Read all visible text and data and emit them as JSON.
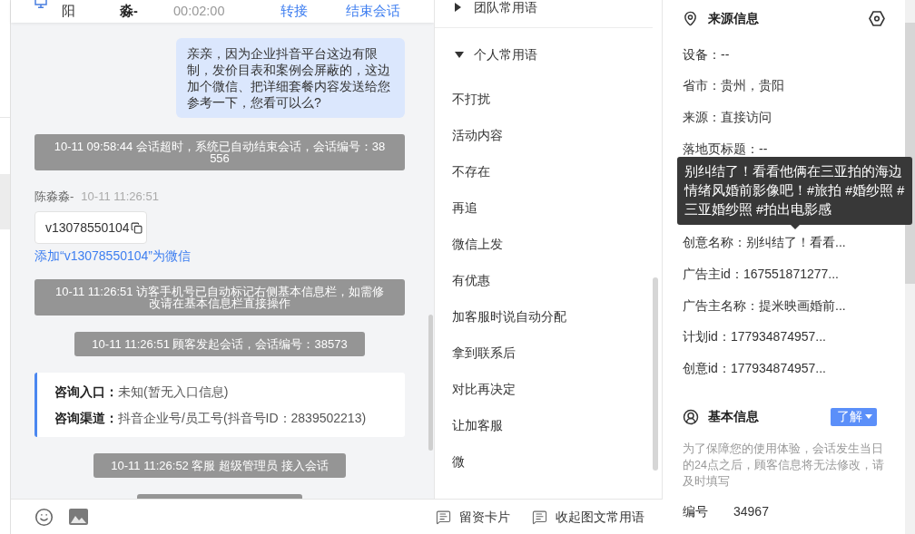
{
  "chat_header": {
    "column_1": "阳",
    "column_2": "淼-",
    "column_3": "00:02:00",
    "actions": [
      "转接",
      "结束会话"
    ]
  },
  "messages": [
    {
      "kind": "outgoing",
      "text": "亲亲，因为企业抖音平台这边有限制，发价目表和案例会屏蔽的，这边加个微信、把详细套餐内容发送给您参考一下，您看可以么?"
    },
    {
      "kind": "system",
      "text": "10-11 09:58:44 会话超时，系统已自动结束会话，会话编号：38556"
    },
    {
      "kind": "incoming",
      "sender": "陈淼淼-",
      "time": "10-11 11:26:51",
      "text": "v13078550104",
      "action": "添加“v13078550104”为微信"
    },
    {
      "kind": "system",
      "text": "10-11 11:26:51 访客手机号已自动标记右侧基本信息栏，如需修改请在基本信息栏直接操作"
    },
    {
      "kind": "system",
      "text": "10-11 11:26:51 顾客发起会话，会话编号：38573"
    },
    {
      "kind": "entry_info",
      "fields": [
        {
          "label": "咨询入口：",
          "value": "未知(暂无入口信息)"
        },
        {
          "label": "咨询渠道：",
          "value": "抖音企业号/员工号(抖音号ID：2839502213)"
        }
      ]
    },
    {
      "kind": "system",
      "text": "10-11 11:26:52 客服 超级管理员 接入会话"
    },
    {
      "kind": "system"
    }
  ],
  "phrase_groups": [
    {
      "title": "团队常用语",
      "expanded": false
    },
    {
      "title": "个人常用语",
      "expanded": true,
      "items": [
        "不打扰",
        "活动内容",
        "不存在",
        "再追",
        "微信上发",
        "有优惠",
        "加客服时说自动分配",
        "拿到联系后",
        "对比再决定",
        "让加客服",
        "微"
      ]
    }
  ],
  "toolbar": {
    "tools": [
      "留资卡片",
      "收起图文常用语"
    ]
  },
  "source_info": {
    "title": "来源信息",
    "rows_above": [
      "设备：--",
      "省市：贵州，贵阳",
      "来源：直接访问",
      "落地页标题：--"
    ],
    "tooltip": "别纠结了！看看他俩在三亚拍的海边情绪风婚前影像吧！#旅拍 #婚纱照 #三亚婚纱照 #拍出电影感",
    "rows_below": [
      "创意名称：别纠结了！看看...",
      "广告主id：167551871277...",
      "广告主名称：提米映画婚前...",
      "计划id：177934874957...",
      "创意id：177934874957..."
    ]
  },
  "basic_info": {
    "title": "基本信息",
    "button": "了解",
    "notice": "为了保障您的使用体验，会话发生当日的24点之后，顾客信息将无法修改，请及时填写",
    "fields": [
      {
        "label": "编号",
        "value": "34967"
      }
    ]
  }
}
